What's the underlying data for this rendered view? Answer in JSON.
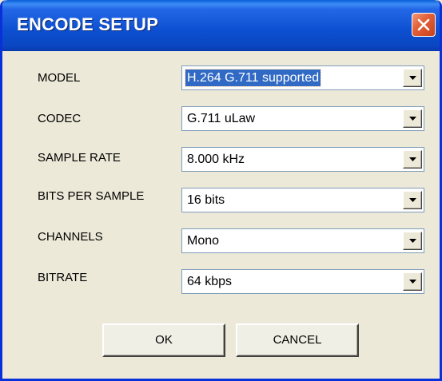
{
  "window": {
    "title": "ENCODE SETUP",
    "close_icon": "close-icon",
    "title_color": "#0a47c2",
    "close_color": "#e2613a"
  },
  "fields": [
    {
      "label": "MODEL",
      "value": "H.264 G.711 supported",
      "selected": true
    },
    {
      "label": "CODEC",
      "value": "G.711 uLaw",
      "selected": false
    },
    {
      "label": "SAMPLE RATE",
      "value": "8.000 kHz",
      "selected": false
    },
    {
      "label": "BITS PER SAMPLE",
      "value": "16 bits",
      "selected": false
    },
    {
      "label": "CHANNELS",
      "value": "Mono",
      "selected": false
    },
    {
      "label": "BITRATE",
      "value": "64 kbps",
      "selected": false
    }
  ],
  "buttons": {
    "ok_label": "OK",
    "cancel_label": "CANCEL"
  },
  "icons": {
    "dropdown": "chevron-down-icon"
  }
}
